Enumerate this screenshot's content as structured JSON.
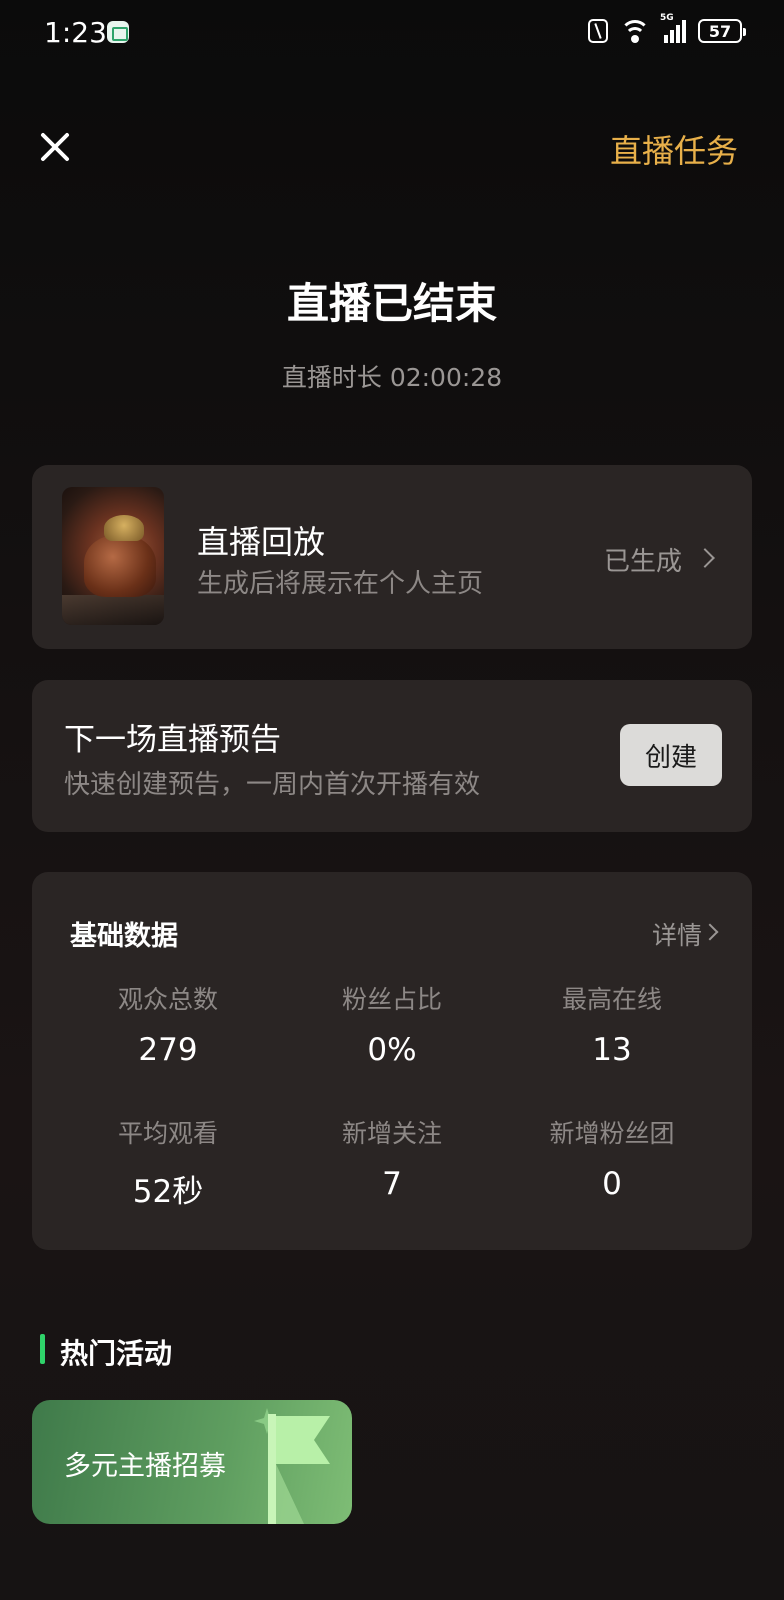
{
  "status_bar": {
    "time": "1:23",
    "network": "5G",
    "battery": "57"
  },
  "header": {
    "task_label": "直播任务"
  },
  "title": "直播已结束",
  "duration": "直播时长 02:00:28",
  "replay": {
    "title": "直播回放",
    "subtitle": "生成后将展示在个人主页",
    "status": "已生成"
  },
  "preview": {
    "title": "下一场直播预告",
    "subtitle": "快速创建预告，一周内首次开播有效",
    "button": "创建"
  },
  "basic_data": {
    "title": "基础数据",
    "detail": "详情",
    "stats": [
      {
        "label": "观众总数",
        "value": "279"
      },
      {
        "label": "粉丝占比",
        "value": "0%"
      },
      {
        "label": "最高在线",
        "value": "13"
      },
      {
        "label": "平均观看",
        "value": "52秒"
      },
      {
        "label": "新增关注",
        "value": "7"
      },
      {
        "label": "新增粉丝团",
        "value": "0"
      }
    ]
  },
  "hot_activities": {
    "title": "热门活动",
    "items": [
      {
        "label": "多元主播招募"
      }
    ]
  },
  "colors": {
    "accent": "#e8b04a",
    "section_marker": "#2fd36a",
    "card_bg": "#2a2524"
  }
}
